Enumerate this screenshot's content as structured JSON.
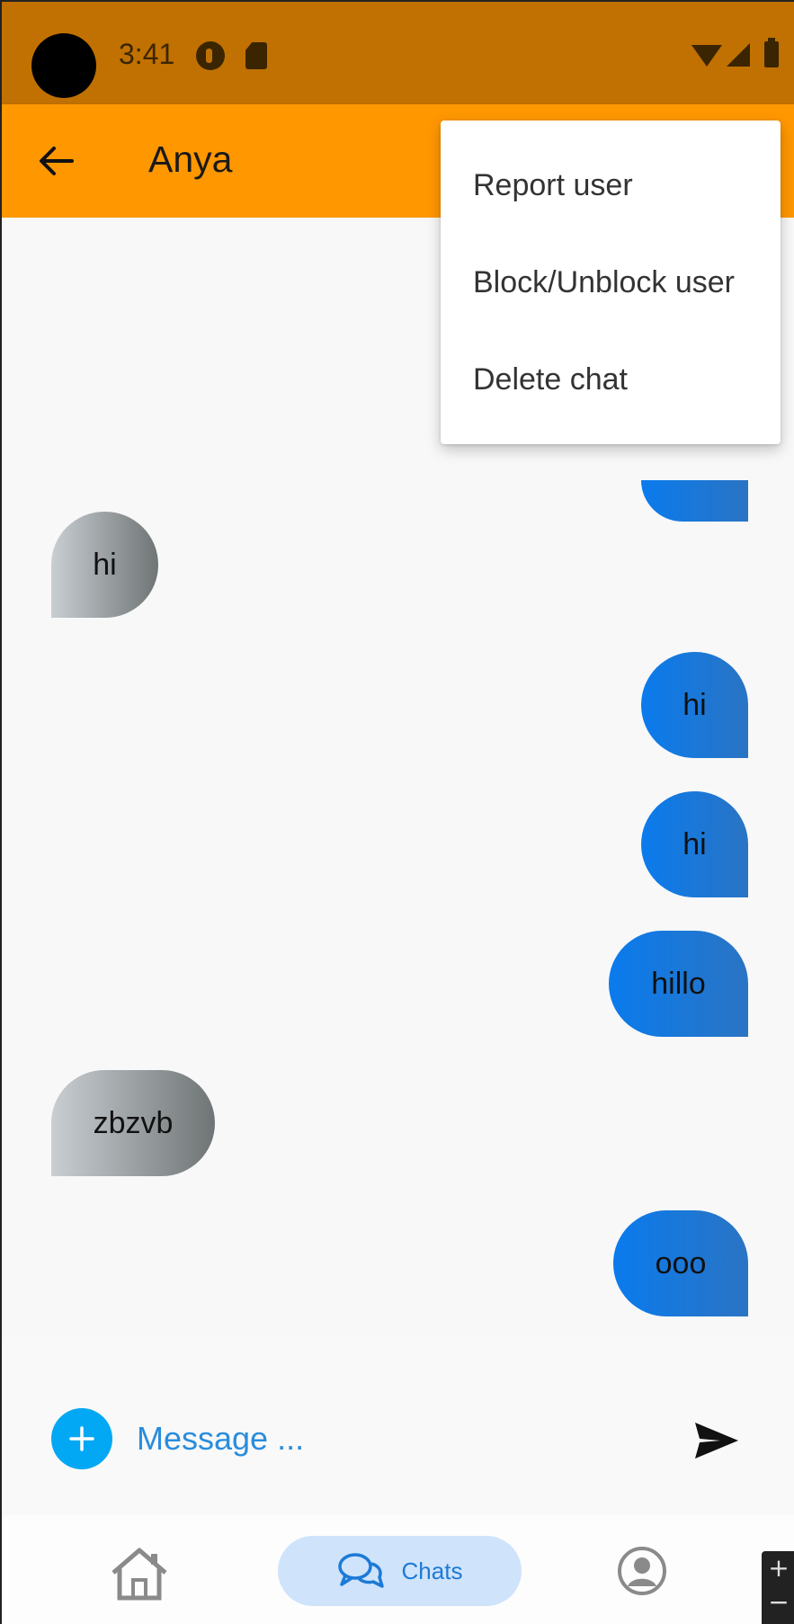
{
  "status_bar": {
    "time": "3:41",
    "background": "#c17101"
  },
  "app_bar": {
    "title": "Anya",
    "background": "#ff9700"
  },
  "messages": [
    {
      "text": "hi",
      "direction": "incoming"
    },
    {
      "text": "hi",
      "direction": "outgoing"
    },
    {
      "text": "hi",
      "direction": "outgoing"
    },
    {
      "text": "hillo",
      "direction": "outgoing"
    },
    {
      "text": "zbzvb",
      "direction": "incoming"
    },
    {
      "text": "ooo",
      "direction": "outgoing"
    }
  ],
  "composer": {
    "placeholder": "Message ..."
  },
  "bottom_nav": {
    "chats_label": "Chats",
    "active_tab": "Chats"
  },
  "popup_menu": {
    "items": [
      "Report user",
      "Block/Unblock user",
      "Delete chat"
    ]
  },
  "zoom_control": {
    "plus": "+",
    "minus": "−"
  },
  "colors": {
    "outgoing_bubble": "#0a7bed",
    "incoming_bubble": "#9aa0a4",
    "accent": "#02a8f3"
  }
}
